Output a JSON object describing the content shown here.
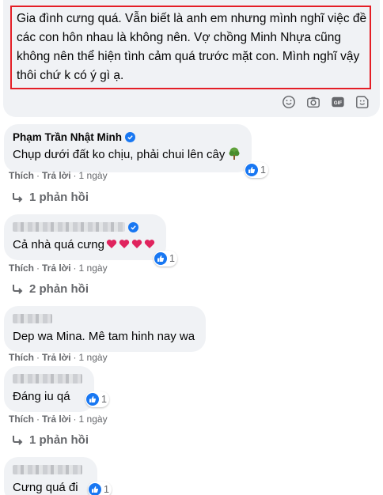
{
  "composer": {
    "text": "Gia đình cưng quá. Vẫn biết là anh em nhưng mình nghĩ việc đề các con hôn nhau là không nên. Vợ chồng Minh Nhựa cũng không nên thể hiện tình cảm quá trước mặt con. Mình nghĩ vậy thôi chứ k có ý gì ạ.",
    "icons": [
      "emoji-icon",
      "camera-icon",
      "gif-icon",
      "sticker-icon"
    ],
    "gif_label": "GIF"
  },
  "comments": [
    {
      "author": "Phạm Trần Nhật Minh",
      "verified": true,
      "text": "Chụp dưới đất ko chịu, phải chui lên cây",
      "reaction_count": "1",
      "like": "Thích",
      "reply": "Trả lời",
      "time": "1 ngày",
      "replies": "1 phản hồi"
    },
    {
      "author": "",
      "verified": true,
      "text": "Cả nhà quá cưng",
      "reaction_count": "1",
      "like": "Thích",
      "reply": "Trả lời",
      "time": "1 ngày",
      "replies": "2 phản hồi"
    },
    {
      "author": "",
      "verified": false,
      "text": "Dep wa Mina. Mê tam hinh nay wa",
      "like": "Thích",
      "reply": "Trả lời",
      "time": "1 ngày"
    },
    {
      "author": "",
      "verified": false,
      "text": "Đáng iu qá",
      "reaction_count": "1",
      "like": "Thích",
      "reply": "Trả lời",
      "time": "1 ngày",
      "replies": "1 phản hồi"
    },
    {
      "author": "",
      "verified": false,
      "text": "Cưng quá đi",
      "reaction_count": "1"
    }
  ],
  "colors": {
    "bubble": "#f0f2f5",
    "highlight": "#e41e26",
    "accent": "#1877f2",
    "heart": "#e0245e",
    "meta": "#65676b"
  }
}
